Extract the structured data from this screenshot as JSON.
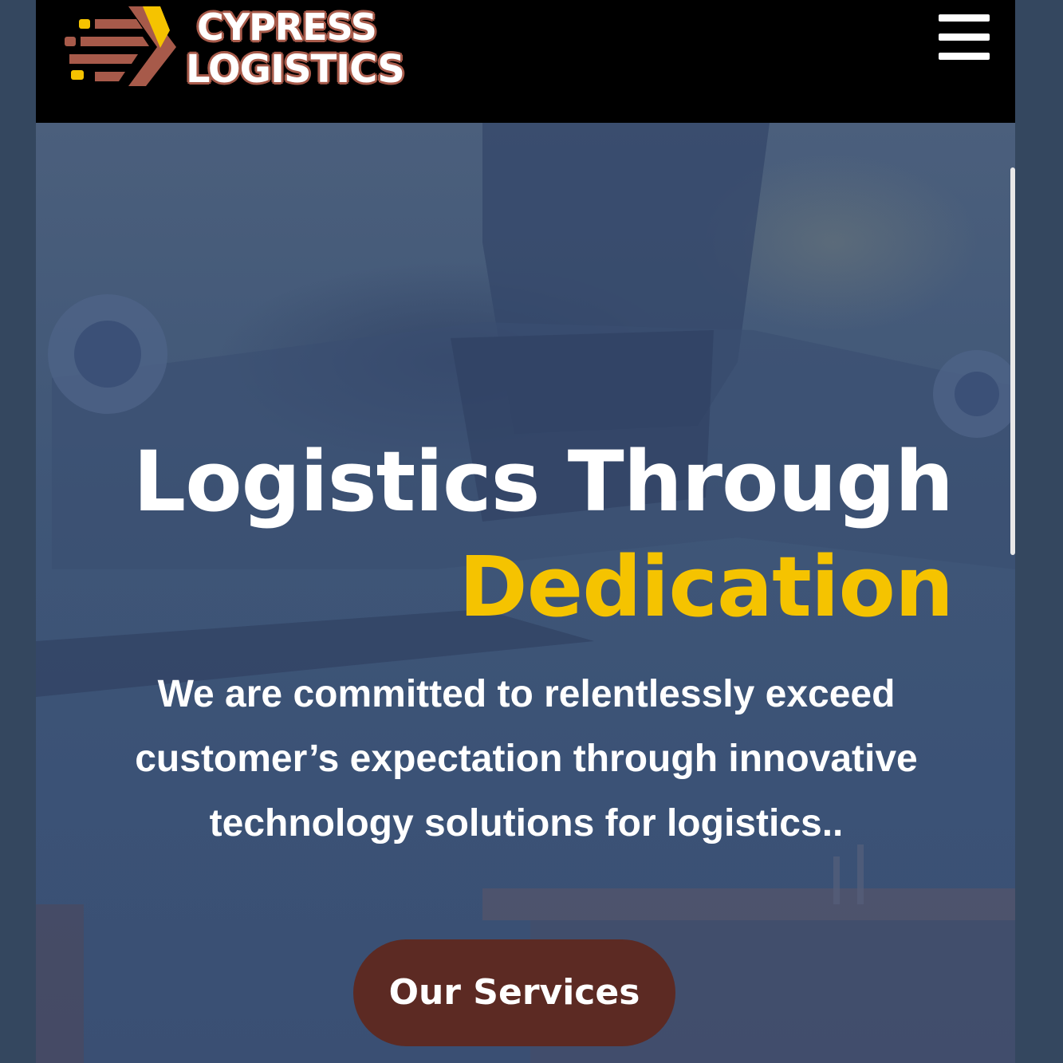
{
  "header": {
    "logo": {
      "line1": "CYPRESS",
      "line2": "LOGISTICS"
    },
    "menu_icon": "hamburger-menu-icon"
  },
  "hero": {
    "title_line1": "Logistics Through",
    "title_line2": "Dedication",
    "subtitle": "We are committed to relentlessly exceed customer’s expectation through innovative technology solutions for logistics..",
    "cta_label": "Our Services"
  },
  "colors": {
    "accent_yellow": "#f5c300",
    "cta_brown": "#5c2a23",
    "logo_brown": "#a75a4a",
    "header_bg": "#000000",
    "hero_overlay": "#3f5677"
  }
}
